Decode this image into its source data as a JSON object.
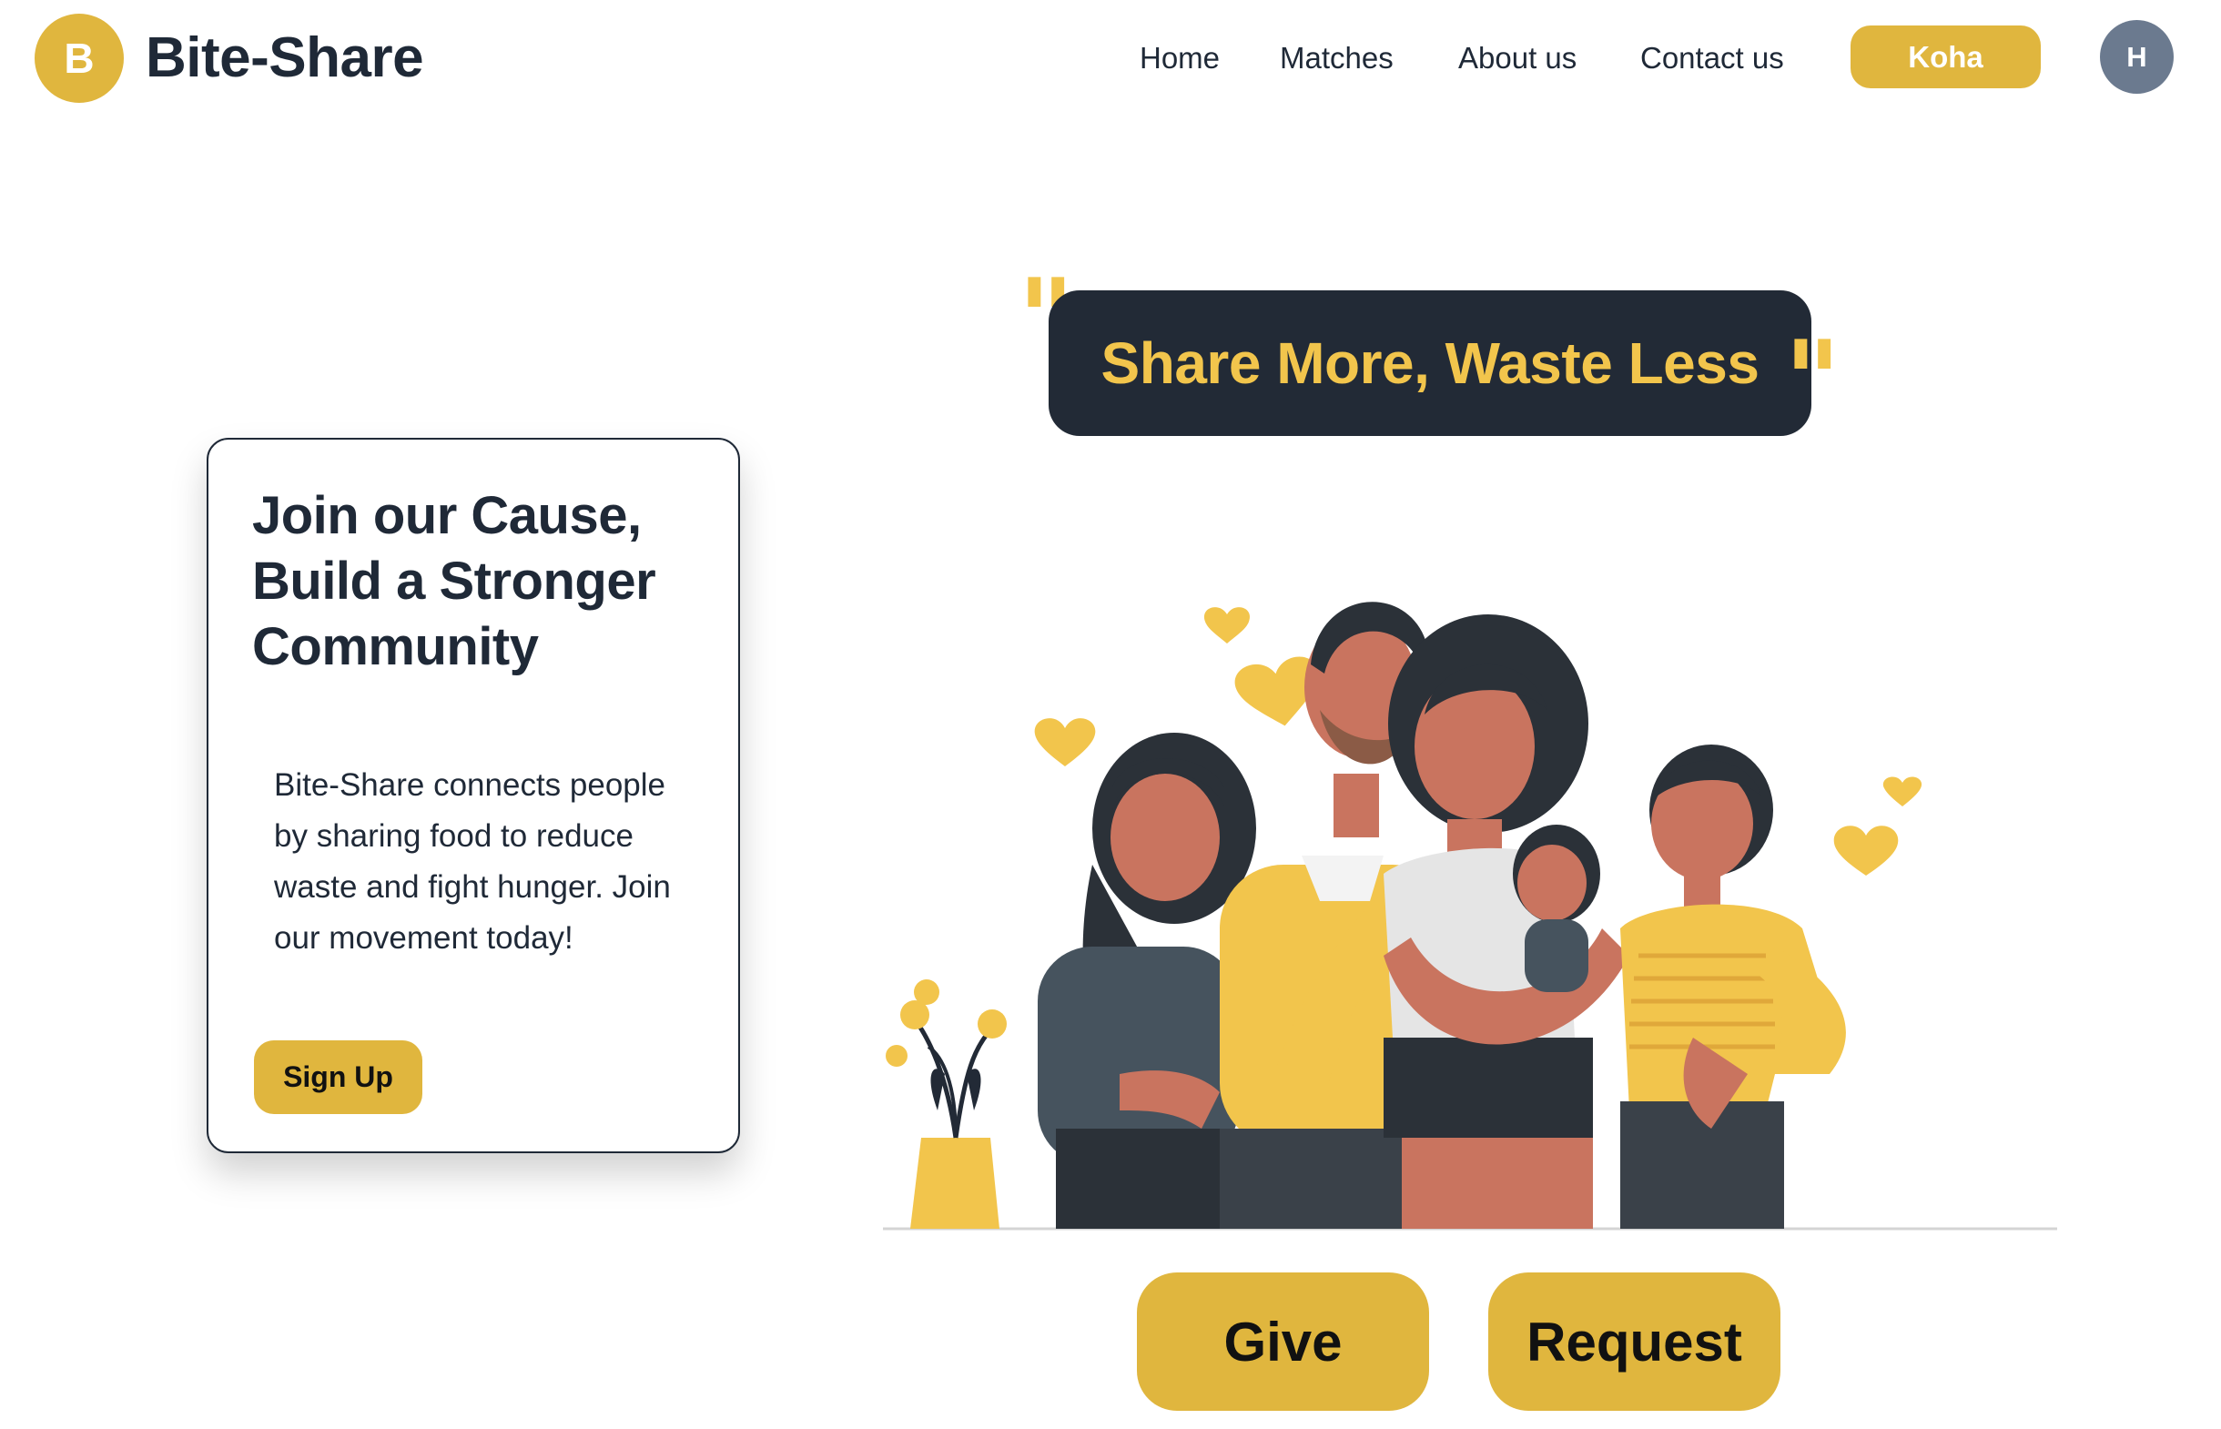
{
  "header": {
    "logo_letter": "B",
    "brand": "Bite-Share",
    "nav": [
      {
        "label": "Home"
      },
      {
        "label": "Matches"
      },
      {
        "label": "About us"
      },
      {
        "label": "Contact us"
      }
    ],
    "koha_label": "Koha",
    "avatar_initial": "H"
  },
  "join_card": {
    "title": "Join our Cause, Build a Stronger Community",
    "text": "Bite-Share connects people by sharing food to reduce waste and fight hunger. Join our movement today!",
    "signup_label": "Sign Up"
  },
  "slogan": {
    "text": "Share More, Waste Less",
    "quote_open": "\"",
    "quote_close": "\""
  },
  "illustration": {
    "icon": "family-illustration"
  },
  "actions": {
    "give_label": "Give",
    "request_label": "Request"
  },
  "colors": {
    "accent": "#e0b63e",
    "dark": "#222a36",
    "text": "#1f2937",
    "slogan_text": "#f2c54c",
    "avatar_bg": "#6b7a8f"
  }
}
